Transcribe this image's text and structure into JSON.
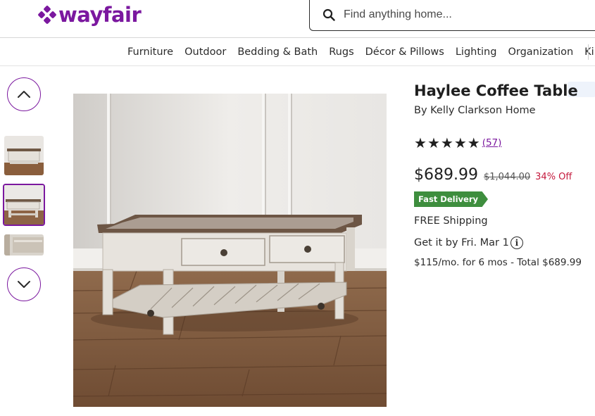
{
  "header": {
    "logo_text": "wayfair",
    "brand_color": "#7b189f",
    "search": {
      "placeholder": "Find anything home...",
      "value": "",
      "icon": "search-icon"
    }
  },
  "category_nav": {
    "items": [
      "Furniture",
      "Outdoor",
      "Bedding & Bath",
      "Rugs",
      "Décor & Pillows",
      "Lighting",
      "Organization",
      "Ki"
    ]
  },
  "gallery": {
    "up_icon": "chevron-up-icon",
    "down_icon": "chevron-down-icon",
    "thumbnails": [
      {
        "name": "thumbnail-1",
        "selected": false
      },
      {
        "name": "thumbnail-2",
        "selected": true
      },
      {
        "name": "thumbnail-3",
        "selected": false
      }
    ]
  },
  "product": {
    "title": "Haylee Coffee Table",
    "brand": "By Kelly Clarkson Home",
    "rating": {
      "stars": 5,
      "review_count": "(57)"
    },
    "price": "$689.99",
    "was_price": "$1,044.00",
    "discount": "34% Off",
    "discount_color": "#c4193c",
    "badge": "Fast Delivery",
    "badge_color": "#3e8e3e",
    "shipping": "FREE Shipping",
    "delivery": "Get it by Fri. Mar 1",
    "delivery_info_icon": "info-icon",
    "financing": "$115/mo. for 6 mos - Total $689.99"
  }
}
